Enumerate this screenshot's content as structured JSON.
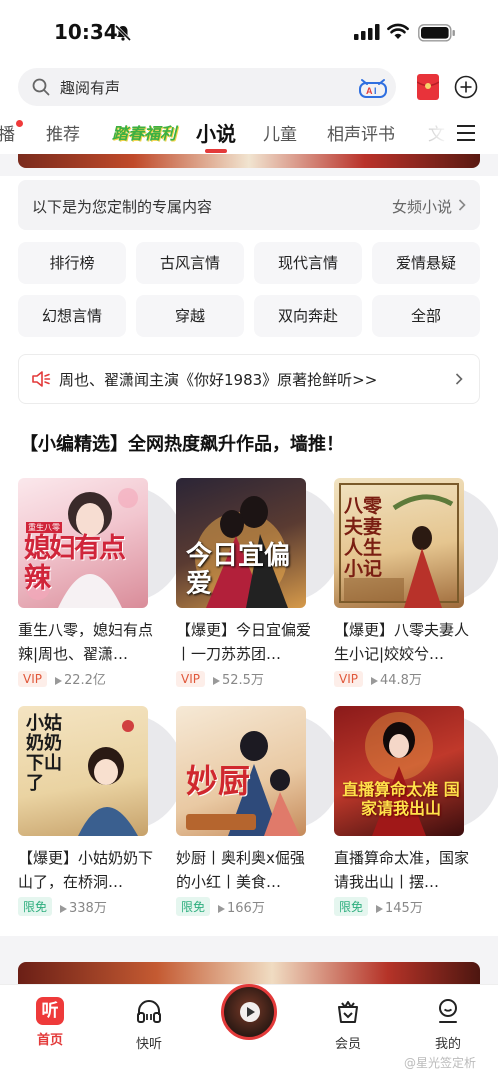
{
  "status": {
    "time": "10:34"
  },
  "search": {
    "placeholder": "趣阅有声"
  },
  "tabs": [
    {
      "label": "播"
    },
    {
      "label": "推荐"
    },
    {
      "label": "踏春福利"
    },
    {
      "label": "小说",
      "active": true
    },
    {
      "label": "儿童"
    },
    {
      "label": "相声评书"
    },
    {
      "label": "文"
    }
  ],
  "custom": {
    "title": "以下是为您定制的专属内容",
    "right": "女频小说"
  },
  "categories": [
    "排行榜",
    "古风言情",
    "现代言情",
    "爱情悬疑",
    "幻想言情",
    "穿越",
    "双向奔赴",
    "全部"
  ],
  "promo": {
    "text": "周也、翟潇闻主演《你好1983》原著抢鲜听>>"
  },
  "section": {
    "title": "【小编精选】全网热度飙升作品，墙推！"
  },
  "books": [
    {
      "title": "重生八零，媳妇有点辣|周也、翟潇…",
      "badge": "VIP",
      "plays": "22.2亿",
      "cover_text": "媳妇有点辣",
      "cover_tag": "重生八零"
    },
    {
      "title": "【爆更】今日宜偏爱丨一刀苏苏团…",
      "badge": "VIP",
      "plays": "52.5万",
      "cover_text": "今日宜偏爱"
    },
    {
      "title": "【爆更】八零夫妻人生小记|姣姣兮…",
      "badge": "VIP",
      "plays": "44.8万",
      "cover_text": "八零夫妻人生小记"
    },
    {
      "title": "【爆更】小姑奶奶下山了，在桥洞…",
      "badge": "限免",
      "plays": "338万",
      "cover_text": "小姑奶奶下山了"
    },
    {
      "title": "妙厨丨奥利奥x倔强的小红丨美食…",
      "badge": "限免",
      "plays": "166万",
      "cover_text": "妙厨"
    },
    {
      "title": "直播算命太准，国家请我出山丨摆…",
      "badge": "限免",
      "plays": "145万",
      "cover_text": "直播算命太准 国家请我出山"
    }
  ],
  "nav": {
    "home": "首页",
    "home_glyph": "听",
    "quick": "快听",
    "member": "会员",
    "mine": "我的"
  },
  "watermark": "@星光签定析"
}
